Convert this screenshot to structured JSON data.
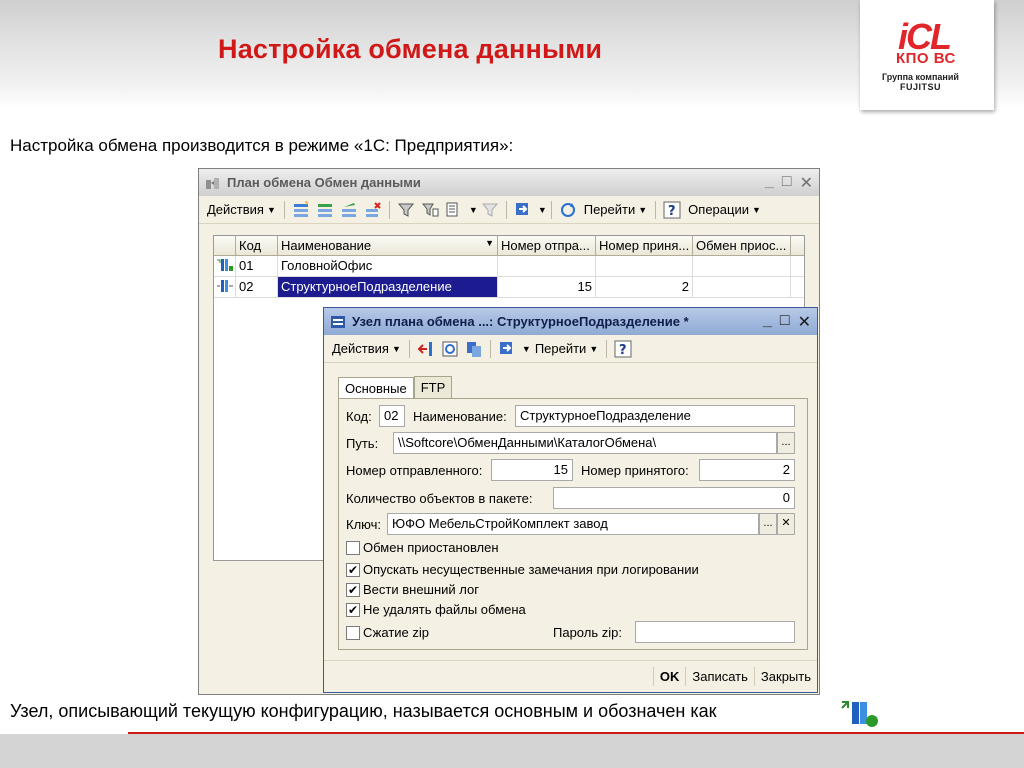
{
  "slide": {
    "title": "Настройка обмена данными",
    "intro": "Настройка обмена производится в режиме «1С: Предприятия»:",
    "bottom_text": "Узел, описывающий текущую конфигурацию, называется основным и обозначен как",
    "logo": {
      "brand": "iCL",
      "sub": "КПО ВС",
      "group": "Группа компаний",
      "parent": "FUJITSU"
    }
  },
  "outer_window": {
    "title": "План обмена Обмен данными",
    "toolbar": {
      "actions": "Действия",
      "goto": "Перейти",
      "operations": "Операции"
    },
    "columns": [
      "Код",
      "Наименование",
      "Номер отпра...",
      "Номер приня...",
      "Обмен приос..."
    ],
    "rows": [
      {
        "code": "01",
        "name": "ГоловнойОфис",
        "sent": "",
        "received": "",
        "paused": ""
      },
      {
        "code": "02",
        "name": "СтруктурноеПодразделение",
        "sent": "15",
        "received": "2",
        "paused": ""
      }
    ]
  },
  "inner_window": {
    "title": "Узел плана обмена ...: СтруктурноеПодразделение *",
    "toolbar": {
      "actions": "Действия",
      "goto": "Перейти"
    },
    "tabs": [
      "Основные",
      "FTP"
    ],
    "form": {
      "code_label": "Код:",
      "code_value": "02",
      "name_label": "Наименование:",
      "name_value": "СтруктурноеПодразделение",
      "path_label": "Путь:",
      "path_value": "\\\\Softcore\\ОбменДанными\\КаталогОбмена\\",
      "sent_label": "Номер отправленного:",
      "sent_value": "15",
      "received_label": "Номер принятого:",
      "received_value": "2",
      "count_label": "Количество объектов в пакете:",
      "count_value": "0",
      "key_label": "Ключ:",
      "key_value": "ЮФО МебельСтройКомплект завод",
      "chk_paused": "Обмен приостановлен",
      "chk_skip": "Опускать несущественные замечания при логировании",
      "chk_log": "Вести внешний лог",
      "chk_keep": "Не удалять файлы обмена",
      "chk_zip": "Сжатие zip",
      "password_label": "Пароль zip:",
      "password_value": ""
    },
    "buttons": {
      "ok": "OK",
      "save": "Записать",
      "close": "Закрыть"
    }
  },
  "colors": {
    "title_red": "#d01818",
    "selection": "#1c1c90",
    "inner_title": "#9fb7dc"
  }
}
